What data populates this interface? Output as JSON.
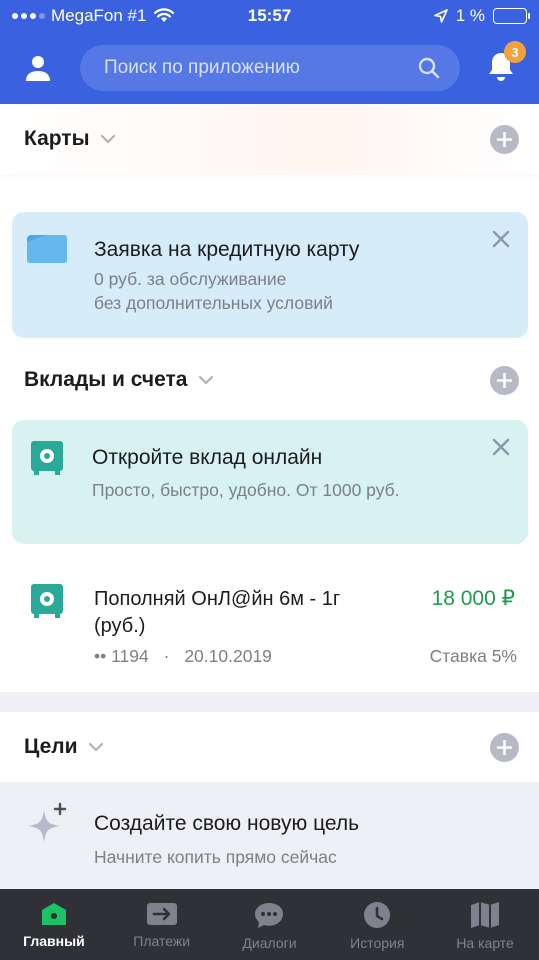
{
  "status": {
    "carrier": "MegaFon #1",
    "time": "15:57",
    "battery": "1 %"
  },
  "header": {
    "search_placeholder": "Поиск по приложению",
    "notifications_count": "3"
  },
  "cards": {
    "title": "Карты",
    "promo": {
      "title": "Заявка на кредитную карту",
      "line1": "0 руб. за обслуживание",
      "line2": "без дополнительных условий"
    }
  },
  "deposits": {
    "title": "Вклады и счета",
    "promo": {
      "title": "Откройте вклад онлайн",
      "subtitle": "Просто, быстро, удобно. От 1000 руб."
    },
    "items": [
      {
        "name": "Пополняй ОнЛ@йн 6м - 1г (руб.)",
        "amount": "18 000 ₽",
        "account": "•• 1194",
        "separator": "·",
        "date": "20.10.2019",
        "rate": "Ставка 5%"
      }
    ]
  },
  "goals": {
    "title": "Цели",
    "promo": {
      "title": "Создайте свою новую цель",
      "subtitle": "Начните копить прямо сейчас"
    }
  },
  "tabbar": {
    "items": [
      {
        "label": "Главный",
        "icon": "home-icon",
        "active": true
      },
      {
        "label": "Платежи",
        "icon": "transfer-icon",
        "active": false
      },
      {
        "label": "Диалоги",
        "icon": "chat-icon",
        "active": false
      },
      {
        "label": "История",
        "icon": "clock-icon",
        "active": false
      },
      {
        "label": "На карте",
        "icon": "map-icon",
        "active": false
      }
    ]
  },
  "colors": {
    "brand_blue": "#3a62e0",
    "accent_green": "#1e9b4d",
    "badge_orange": "#f4a13a",
    "credit_card_promo_bg": "#d6ecf8",
    "deposit_promo_bg": "#d8f1f1",
    "safe_teal": "#2aa99b"
  }
}
